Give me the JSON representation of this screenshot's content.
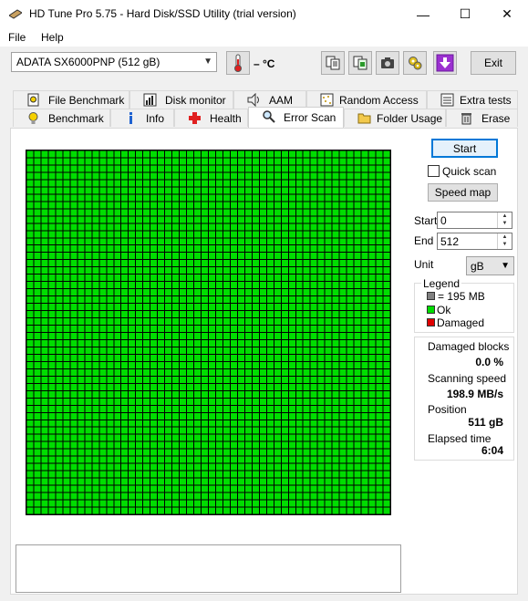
{
  "window": {
    "title": "HD Tune Pro 5.75 - Hard Disk/SSD Utility (trial version)",
    "min_glyph": "—",
    "max_glyph": "☐",
    "close_glyph": "✕"
  },
  "menu": {
    "file": "File",
    "help": "Help"
  },
  "toolbar": {
    "drive": "ADATA SX6000PNP (512 gB)",
    "temperature": "– °C",
    "exit_label": "Exit"
  },
  "tabs": {
    "row1": [
      {
        "label": "File Benchmark",
        "icon": "file-benchmark-icon"
      },
      {
        "label": "Disk monitor",
        "icon": "disk-monitor-icon"
      },
      {
        "label": "AAM",
        "icon": "speaker-icon"
      },
      {
        "label": "Random Access",
        "icon": "random-access-icon"
      },
      {
        "label": "Extra tests",
        "icon": "extra-tests-icon"
      }
    ],
    "row2": [
      {
        "label": "Benchmark",
        "icon": "lightbulb-icon"
      },
      {
        "label": "Info",
        "icon": "info-icon"
      },
      {
        "label": "Health",
        "icon": "health-cross-icon"
      },
      {
        "label": "Error Scan",
        "icon": "magnifier-icon",
        "active": true
      },
      {
        "label": "Folder Usage",
        "icon": "folder-icon"
      },
      {
        "label": "Erase",
        "icon": "trash-icon"
      }
    ]
  },
  "scan": {
    "start_button": "Start",
    "quick_scan_label": "Quick scan",
    "quick_scan_checked": false,
    "speed_map_button": "Speed map",
    "start_label": "Start",
    "start_value": "0",
    "end_label": "End",
    "end_value": "512",
    "unit_label": "Unit",
    "unit_value": "gB",
    "block_states": "all ok"
  },
  "legend": {
    "title": "Legend",
    "block_size": "= 195 MB",
    "ok": "Ok",
    "damaged": "Damaged"
  },
  "stats": {
    "damaged_blocks_label": "Damaged blocks",
    "damaged_blocks_value": "0.0 %",
    "scanning_speed_label": "Scanning speed",
    "scanning_speed_value": "198.9 MB/s",
    "position_label": "Position",
    "position_value": "511 gB",
    "elapsed_label": "Elapsed time",
    "elapsed_value": "6:04"
  },
  "colors": {
    "ok_block": "#00dd00",
    "damaged_block": "#e00000",
    "block_size_swatch": "#808080",
    "grid_lines": "#000000",
    "accent_border": "#0078d7"
  }
}
